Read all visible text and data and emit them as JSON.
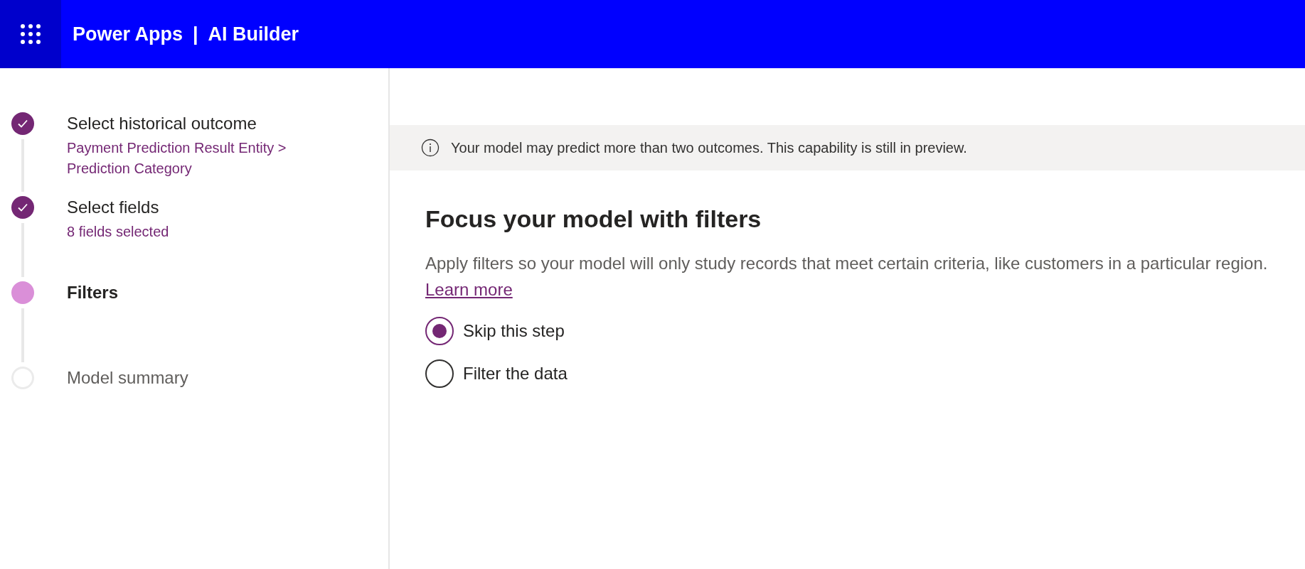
{
  "header": {
    "title": "Power Apps",
    "separator": "|",
    "product": "AI Builder"
  },
  "steps": [
    {
      "label": "Select historical outcome",
      "completed": true,
      "current": false,
      "subtitle": "Payment Prediction Result Entity > Prediction Category"
    },
    {
      "label": "Select fields",
      "completed": true,
      "current": false,
      "subtitle": "8 fields selected"
    },
    {
      "label": "Filters",
      "completed": false,
      "current": true
    },
    {
      "label": "Model summary",
      "completed": false,
      "current": false
    }
  ],
  "banner": {
    "text": "Your model may predict more than two outcomes. This capability is still in preview."
  },
  "heading": "Focus your model with filters",
  "description": "Apply filters so your model will only study records that meet certain criteria, like customers in a particular region.",
  "link": "Learn more",
  "options": [
    {
      "label": "Skip this step",
      "selected": true
    },
    {
      "label": "Filter the data",
      "selected": false
    }
  ]
}
